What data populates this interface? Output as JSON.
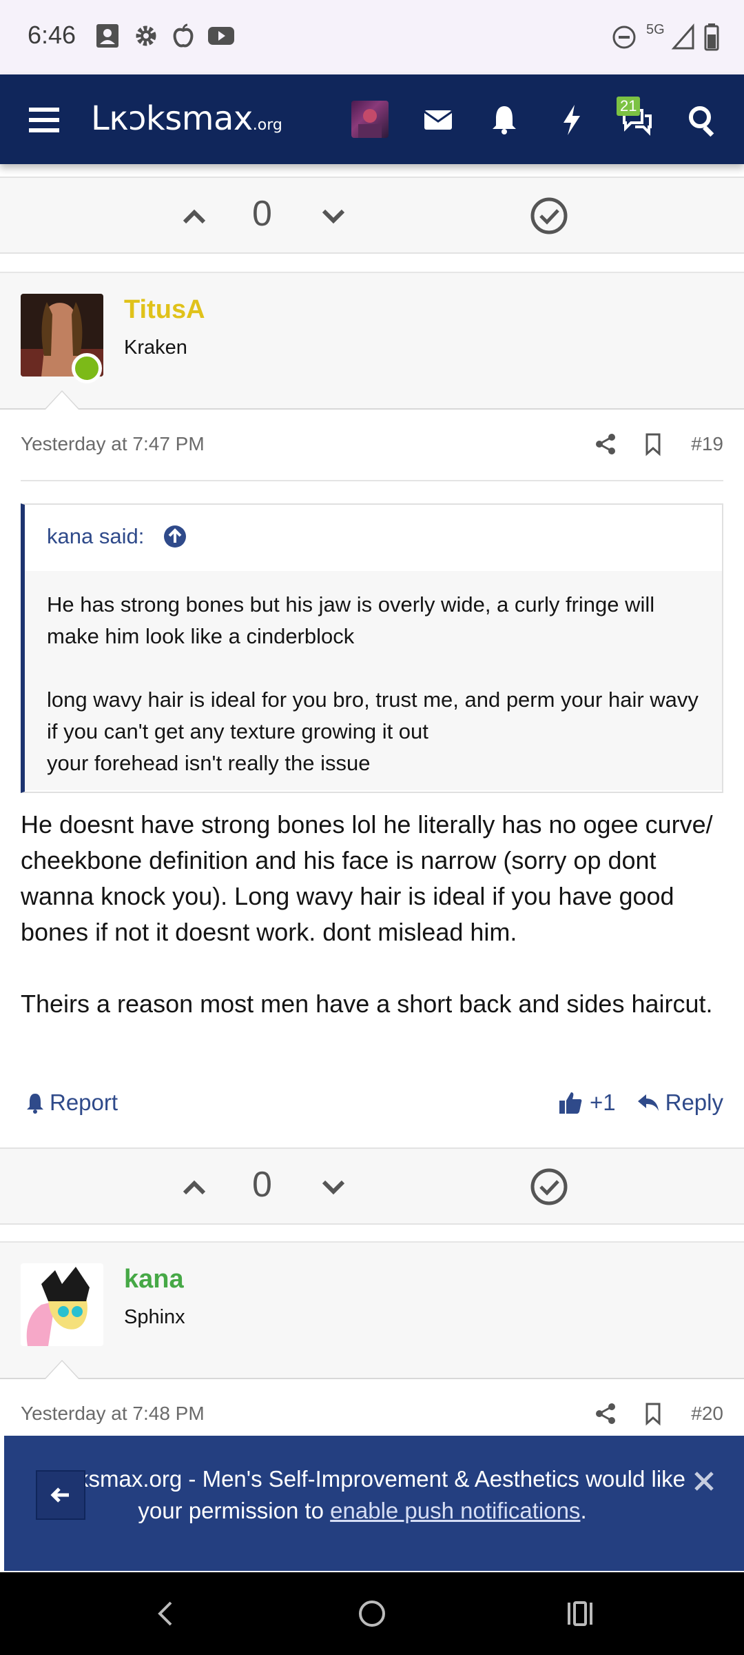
{
  "status_bar": {
    "time": "6:46",
    "network": "5G",
    "icons": [
      "contact-card-icon",
      "gear-icon",
      "apple-icon",
      "youtube-icon",
      "do-not-disturb-icon",
      "signal-icon",
      "battery-icon"
    ]
  },
  "navbar": {
    "logo_main": "Lκɔksmax",
    "logo_suffix": ".org",
    "conversations_badge": "21",
    "colors": {
      "bar": "#10265b",
      "badge": "#7cc243"
    }
  },
  "votes": [
    {
      "count": "0"
    },
    {
      "count": "0"
    }
  ],
  "posts": [
    {
      "author": "TitusA",
      "author_color": "#e0c21a",
      "user_title": "Kraken",
      "date": "Yesterday at 7:47 PM",
      "number": "#19",
      "quote": {
        "author": "kana said:",
        "paragraphs": [
          "He has strong bones but his jaw is overly wide, a curly fringe will make him look like a cinderblock",
          "long wavy hair is ideal for you bro, trust me, and perm your hair wavy if you can't get any texture growing it out\nyour forehead isn't really the issue"
        ]
      },
      "body": [
        "He doesnt have strong bones lol he literally has no ogee curve/ cheekbone definition and his face is narrow (sorry op dont wanna knock you). Long wavy hair is ideal if you have good bones if not it doesnt work. dont mislead him.",
        "Theirs a reason most men have a short back and sides haircut."
      ],
      "actions": {
        "report": "Report",
        "like": "+1",
        "reply": "Reply"
      }
    },
    {
      "author": "kana",
      "author_color": "#46a846",
      "user_title": "Sphinx",
      "date": "Yesterday at 7:48 PM",
      "number": "#20"
    }
  ],
  "push_banner": {
    "text_before": "Looksmax.org - Men's Self-Improvement & Aesthetics would like your permission to ",
    "link": "enable push notifications",
    "text_after": "."
  }
}
